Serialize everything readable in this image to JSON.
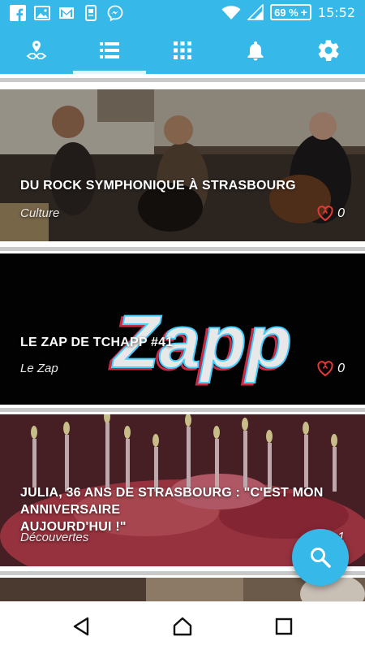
{
  "status_bar": {
    "left_icons": [
      "facebook-icon",
      "gallery-icon",
      "gmail-icon",
      "phone-app-icon",
      "messenger-icon"
    ],
    "battery_percent": "69 %",
    "charging": "+",
    "time": "15:52"
  },
  "toolbar": {
    "tabs": [
      {
        "icon": "map-pin-icon",
        "selected": false
      },
      {
        "icon": "list-icon",
        "selected": true
      },
      {
        "icon": "grid-icon",
        "selected": false
      },
      {
        "icon": "bell-icon",
        "selected": false
      },
      {
        "icon": "gear-icon",
        "selected": false
      }
    ]
  },
  "feed": {
    "items": [
      {
        "title": "DU ROCK SYMPHONIQUE À STRASBOURG",
        "category": "Culture",
        "likes": "0"
      },
      {
        "title": "LE ZAP DE TCHAPP #41",
        "category": "Le Zap",
        "likes": "0",
        "overlay_text": "Zapp"
      },
      {
        "title": "JULIA, 36 ANS DE STRASBOURG : \"C'EST MON ANNIVERSAIRE\nAUJOURD'HUI !\"",
        "category": "Découvertes",
        "likes": "1"
      }
    ]
  },
  "fab": {
    "icon": "search-icon"
  },
  "nav_bar": {
    "icons": [
      "back-icon",
      "home-icon",
      "recents-icon"
    ]
  },
  "colors": {
    "accent": "#36b9e8",
    "like": "#e53935"
  }
}
